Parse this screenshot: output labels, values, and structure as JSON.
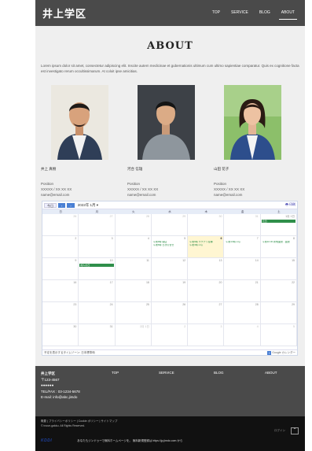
{
  "header": {
    "logo": "井上学区",
    "nav": [
      {
        "label": "TOP"
      },
      {
        "label": "SERVICE"
      },
      {
        "label": "BLOG"
      },
      {
        "label": "ABOUT"
      }
    ]
  },
  "main": {
    "title": "ABOUT",
    "intro": "Lorem ipsum dolor sit amet, consectetur adipiscing elit. Inscite autem medicinae et gubernationis ultimum cum ultimo sapientiae comparatur. Quis ex cognitione facta est investigato rerum occultissimarum. At coloit ipse amicitias."
  },
  "members": [
    {
      "name": "井上 真樹",
      "position": "Position",
      "tel": "XXXXX / XX XX XX",
      "email": "name@email.com"
    },
    {
      "name": "河合 信雄",
      "position": "Position",
      "tel": "XXXXX / XX XX XX",
      "email": "name@email.com"
    },
    {
      "name": "山田 花子",
      "position": "Position",
      "tel": "XXXXX / XX XX XX",
      "email": "name@email.com"
    }
  ],
  "calendar": {
    "today_label": "今日",
    "prev_label": "‹",
    "next_label": "›",
    "month": "2022年 1月 ▾",
    "print_label": "印刷",
    "weekdays": [
      "日",
      "月",
      "火",
      "水",
      "木",
      "金",
      "土"
    ],
    "weeks": [
      [
        {
          "d": "26",
          "o": true
        },
        {
          "d": "27",
          "o": true
        },
        {
          "d": "28",
          "o": true
        },
        {
          "d": "29",
          "o": true
        },
        {
          "d": "30",
          "o": true
        },
        {
          "d": "31",
          "o": true
        },
        {
          "d": "1月 1日"
        }
      ],
      [
        {
          "d": "2"
        },
        {
          "d": "3"
        },
        {
          "d": "4"
        },
        {
          "d": "5"
        },
        {
          "d": "6",
          "today": true
        },
        {
          "d": "7"
        },
        {
          "d": "8"
        }
      ],
      [
        {
          "d": "9"
        },
        {
          "d": "10"
        },
        {
          "d": "11"
        },
        {
          "d": "12"
        },
        {
          "d": "13"
        },
        {
          "d": "14"
        },
        {
          "d": "15"
        }
      ],
      [
        {
          "d": "16"
        },
        {
          "d": "17"
        },
        {
          "d": "18"
        },
        {
          "d": "19"
        },
        {
          "d": "20"
        },
        {
          "d": "21"
        },
        {
          "d": "22"
        }
      ],
      [
        {
          "d": "23"
        },
        {
          "d": "24"
        },
        {
          "d": "25"
        },
        {
          "d": "26"
        },
        {
          "d": "27"
        },
        {
          "d": "28"
        },
        {
          "d": "29"
        }
      ],
      [
        {
          "d": "30"
        },
        {
          "d": "31"
        },
        {
          "d": "2月 1日",
          "o": true
        },
        {
          "d": "2",
          "o": true
        },
        {
          "d": "3",
          "o": true
        },
        {
          "d": "4",
          "o": true
        },
        {
          "d": "5",
          "o": true
        }
      ]
    ],
    "events": [
      {
        "week": 0,
        "day": 6,
        "label": "元日",
        "style": "bar"
      },
      {
        "week": 1,
        "day": 3,
        "label": "午前9時 開店",
        "style": "text",
        "row": 0
      },
      {
        "week": 1,
        "day": 3,
        "label": "午後6時 日次打合せ",
        "style": "text",
        "row": 1
      },
      {
        "week": 1,
        "day": 4,
        "label": "午前9時 ワクチン接種",
        "style": "text",
        "row": 0
      },
      {
        "week": 1,
        "day": 4,
        "label": "午後3時 mtg",
        "style": "text",
        "row": 1
      },
      {
        "week": 1,
        "day": 5,
        "label": "午前10時 mtg",
        "style": "text",
        "row": 0
      },
      {
        "week": 1,
        "day": 6,
        "label": "午前10:30 新規面談 - 面談",
        "style": "text",
        "row": 0
      },
      {
        "week": 2,
        "day": 1,
        "label": "成人の日",
        "style": "bar"
      }
    ],
    "timezone": "予定を表示するタイムゾーン: 日本標準時",
    "google_label": "Google カレンダー"
  },
  "footer": {
    "company": "井上学区",
    "zip": "〒123-4567",
    "address": "●●●●●●",
    "tel": "TEL/FAX : 03-1234-5678",
    "email": "E-mail: info@abc.jimdo",
    "links": [
      {
        "label": "TOP"
      },
      {
        "label": "SERVICE"
      },
      {
        "label": "BLOG"
      },
      {
        "label": "ABOUT"
      }
    ]
  },
  "bottom": {
    "policy": "概要 | プライバシーポリシー | Cookie ポリシー | サイトマップ",
    "copyright": "© inoue-gakku. All Rights Reserved.",
    "login": "ログイン",
    "totop": "⌃",
    "brand": "KDDI",
    "ad_text": "あなたもジンドゥーで無料ホームページを。 無料新規登録は https://jp.jimdo.com から"
  },
  "colors": {
    "header_bg": "#4a4a4a",
    "main_bg": "#efefef",
    "event_green": "#2f8f4a",
    "today_bg": "#fff6d2",
    "calendar_blue": "#4a7fd4"
  }
}
